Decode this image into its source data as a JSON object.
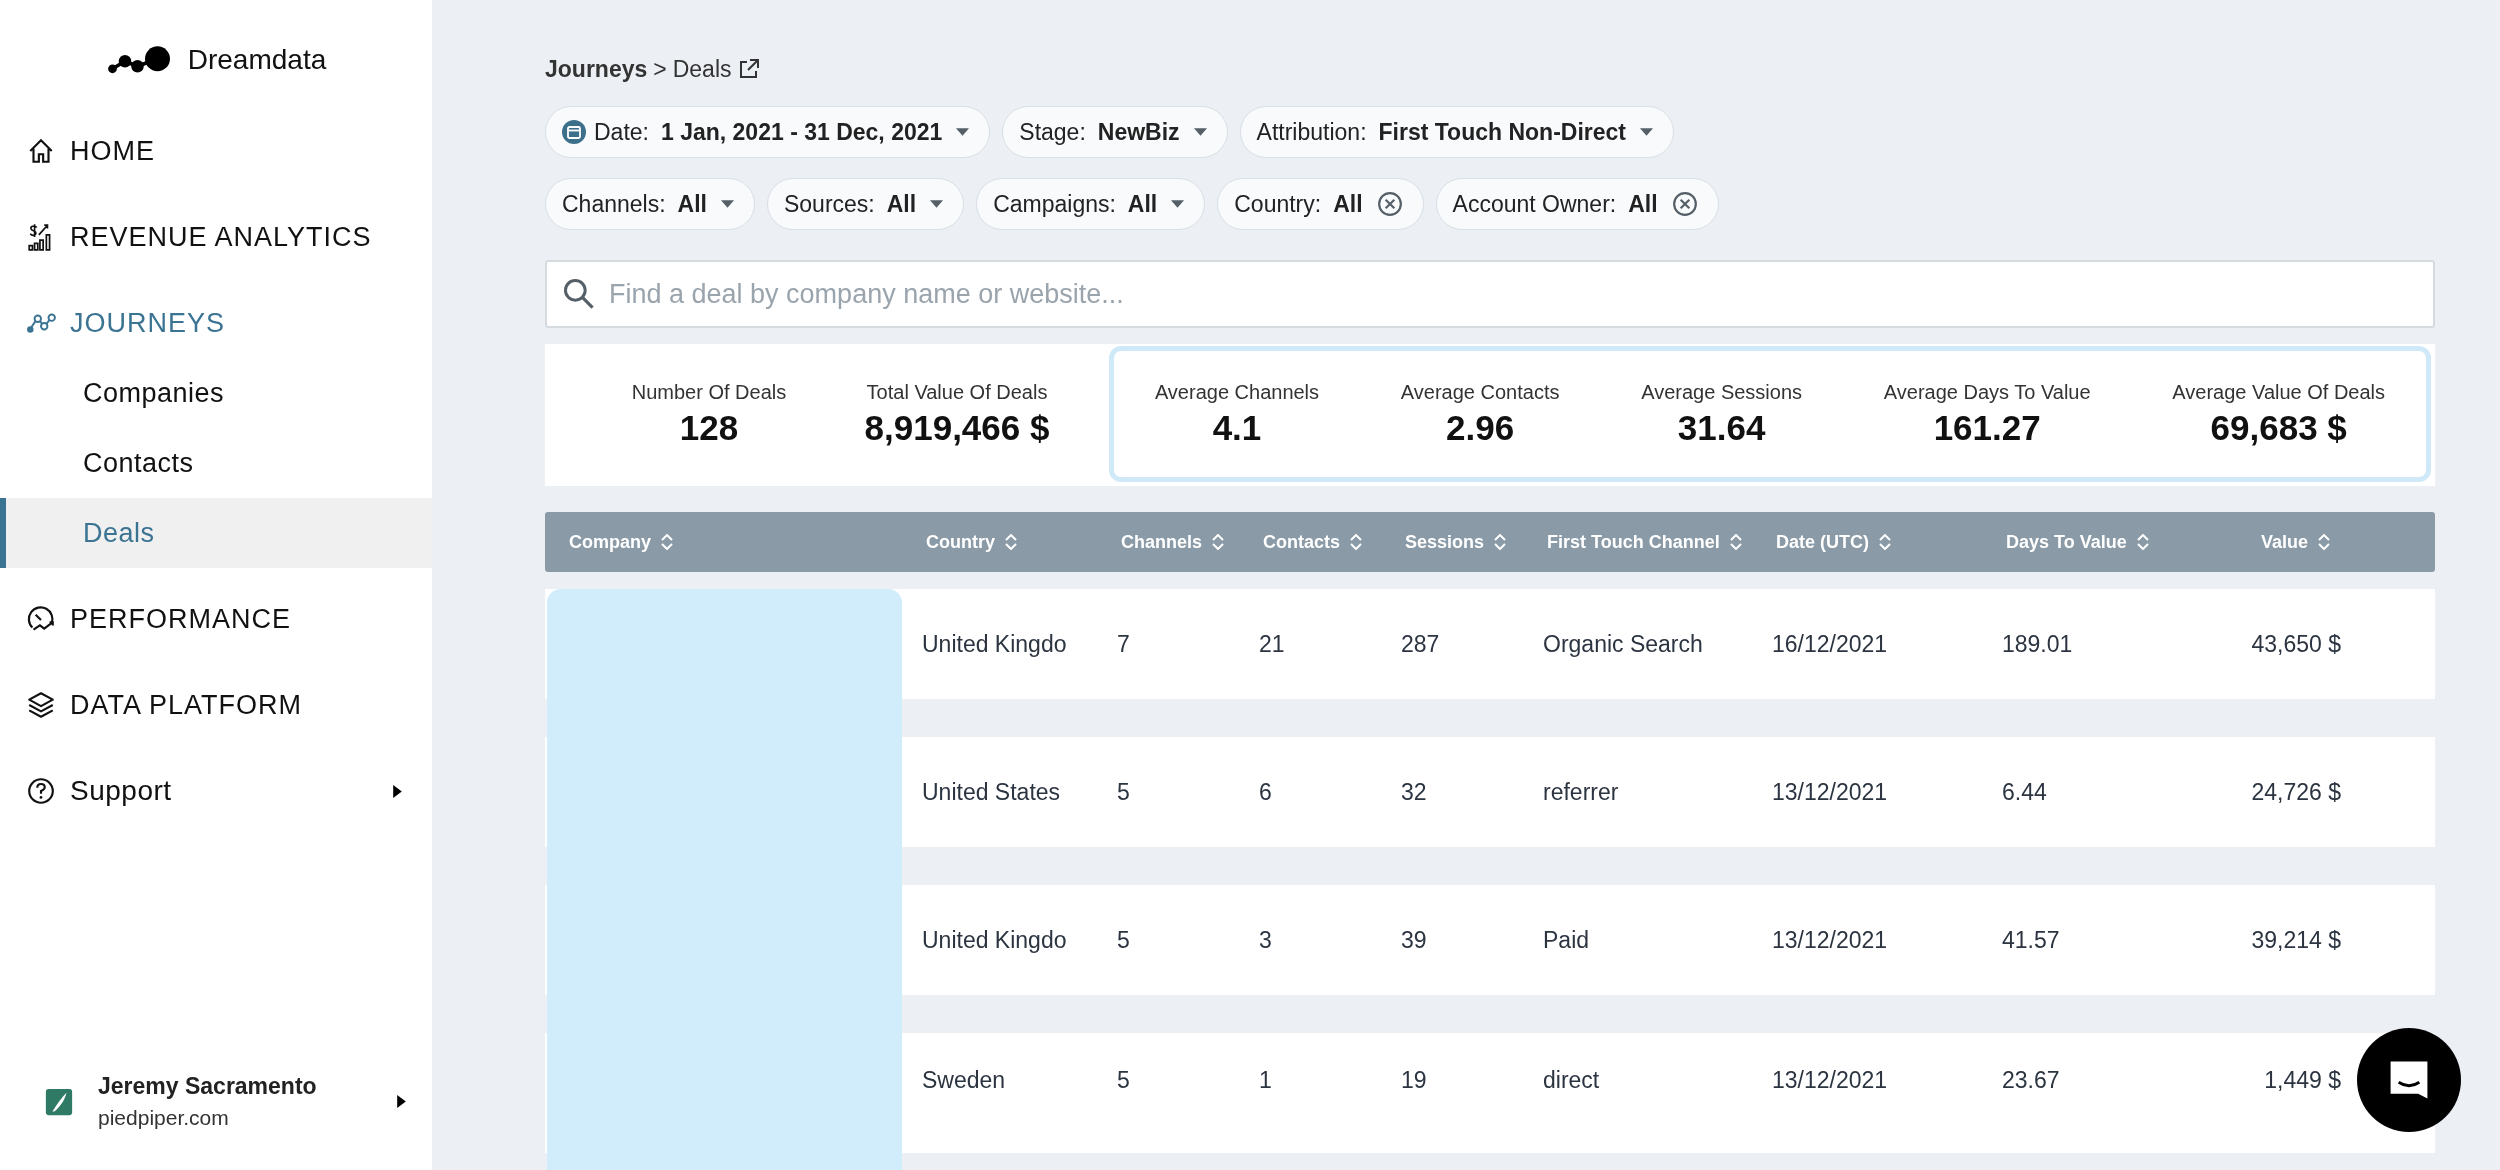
{
  "sidebar": {
    "brand": "Dreamdata",
    "items": [
      {
        "label": "HOME",
        "kind": "link",
        "active": false
      },
      {
        "label": "REVENUE ANALYTICS",
        "kind": "link",
        "active": false
      },
      {
        "label": "JOURNEYS",
        "kind": "link",
        "active": true,
        "children": [
          {
            "label": "Companies",
            "selected": false
          },
          {
            "label": "Contacts",
            "selected": false
          },
          {
            "label": "Deals",
            "selected": true
          }
        ]
      },
      {
        "label": "PERFORMANCE",
        "kind": "link",
        "active": false
      },
      {
        "label": "DATA PLATFORM",
        "kind": "link",
        "active": false
      },
      {
        "label": "Support",
        "kind": "submenu",
        "active": false
      }
    ],
    "user": {
      "name": "Jeremy Sacramento",
      "domain": "piedpiper.com"
    }
  },
  "breadcrumb": {
    "parent": "Journeys",
    "separator": ">",
    "current": "Deals"
  },
  "filter_rows": [
    [
      {
        "kind": "date",
        "label": "Date:",
        "value": "1 Jan, 2021 - 31 Dec, 2021"
      },
      {
        "kind": "dropdown",
        "label": "Stage:",
        "value": "NewBiz"
      },
      {
        "kind": "dropdown",
        "label": "Attribution:",
        "value": "First Touch Non-Direct"
      }
    ],
    [
      {
        "kind": "dropdown",
        "label": "Channels:",
        "value": "All"
      },
      {
        "kind": "dropdown",
        "label": "Sources:",
        "value": "All"
      },
      {
        "kind": "dropdown",
        "label": "Campaigns:",
        "value": "All"
      },
      {
        "kind": "clearable",
        "label": "Country:",
        "value": "All"
      },
      {
        "kind": "clearable",
        "label": "Account Owner:",
        "value": "All"
      }
    ]
  ],
  "search": {
    "placeholder": "Find a deal by company name or website..."
  },
  "stats": [
    {
      "label": "Number Of Deals",
      "value": "128",
      "highlighted": false
    },
    {
      "label": "Total Value Of Deals",
      "value": "8,919,466 $",
      "highlighted": false
    },
    {
      "label": "Average Channels",
      "value": "4.1",
      "highlighted": true
    },
    {
      "label": "Average Contacts",
      "value": "2.96",
      "highlighted": true
    },
    {
      "label": "Average Sessions",
      "value": "31.64",
      "highlighted": true
    },
    {
      "label": "Average Days To Value",
      "value": "161.27",
      "highlighted": true
    },
    {
      "label": "Average Value Of Deals",
      "value": "69,683 $",
      "highlighted": true
    }
  ],
  "table": {
    "columns": [
      "Company",
      "Country",
      "Channels",
      "Contacts",
      "Sessions",
      "First Touch Channel",
      "Date (UTC)",
      "Days To Value",
      "Value"
    ],
    "rows": [
      [
        "",
        "United Kingdo",
        "7",
        "21",
        "287",
        "Organic Search",
        "16/12/2021",
        "189.01",
        "43,650 $"
      ],
      [
        "",
        "United States",
        "5",
        "6",
        "32",
        "referrer",
        "13/12/2021",
        "6.44",
        "24,726 $"
      ],
      [
        "",
        "United Kingdo",
        "5",
        "3",
        "39",
        "Paid",
        "13/12/2021",
        "41.57",
        "39,214 $"
      ],
      [
        "",
        "Sweden",
        "5",
        "1",
        "19",
        "direct",
        "13/12/2021",
        "23.67",
        "1,449 $"
      ]
    ]
  }
}
